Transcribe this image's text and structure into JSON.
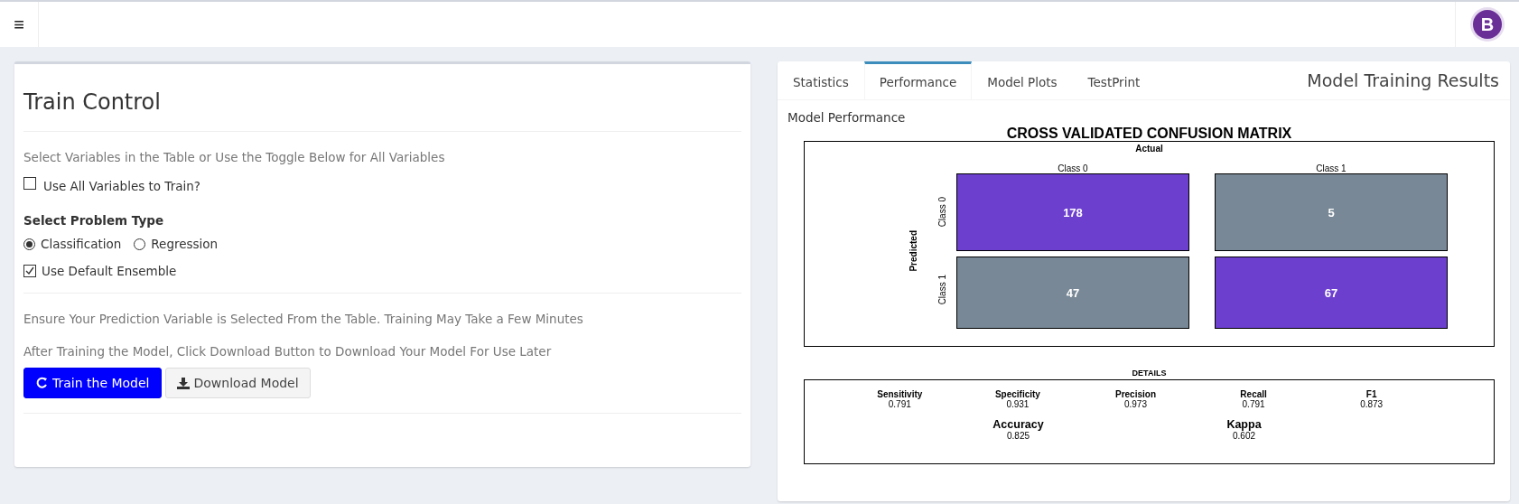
{
  "header": {
    "menu_glyph": "≡",
    "logo": {
      "letter": "B"
    }
  },
  "train_control": {
    "title": "Train Control",
    "hint": "Select Variables in the Table or Use the Toggle Below for All Variables",
    "use_all": {
      "label": "Use All Variables to Train?",
      "checked": false
    },
    "problem_type": {
      "label": "Select Problem Type",
      "options": [
        {
          "label": "Classification",
          "selected": true
        },
        {
          "label": "Regression",
          "selected": false
        }
      ]
    },
    "ensemble": {
      "label": "Use Default Ensemble",
      "checked": true
    },
    "notes": [
      "Ensure Your Prediction Variable is Selected From the Table. Training May Take a Few Minutes",
      "After Training the Model, Click Download Button to Download Your Model For Use Later"
    ],
    "buttons": [
      {
        "label": "Train the Model",
        "kind": "primary"
      },
      {
        "label": "Download Model",
        "kind": "download"
      }
    ]
  },
  "results": {
    "title": "Model Training Results",
    "tabs": [
      {
        "label": "Statistics",
        "selected": false
      },
      {
        "label": "Performance",
        "selected": true
      },
      {
        "label": "Model Plots",
        "selected": false
      },
      {
        "label": "TestPrint",
        "selected": false
      }
    ],
    "section_label": "Model Performance",
    "matrix": {
      "title": "CROSS VALIDATED CONFUSION MATRIX",
      "actual_label": "Actual",
      "predicted_label": "Predicted",
      "columns": [
        "Class 0",
        "Class 1"
      ],
      "rows": [
        {
          "label": "Class 0",
          "cells": [
            {
              "value": "178",
              "color": "#6c3fcf"
            },
            {
              "value": "5",
              "color": "#788896"
            }
          ]
        },
        {
          "label": "Class 1",
          "cells": [
            {
              "value": "47",
              "color": "#788896"
            },
            {
              "value": "67",
              "color": "#6c3fcf"
            }
          ]
        }
      ]
    },
    "details": {
      "title": "DETAILS",
      "metrics": [
        {
          "name": "Sensitivity",
          "value": "0.791"
        },
        {
          "name": "Specificity",
          "value": "0.931"
        },
        {
          "name": "Precision",
          "value": "0.973"
        },
        {
          "name": "Recall",
          "value": "0.791"
        },
        {
          "name": "F1",
          "value": "0.873"
        }
      ],
      "summary": [
        {
          "name": "Accuracy",
          "value": "0.825"
        },
        {
          "name": "Kappa",
          "value": "0.602"
        }
      ]
    }
  }
}
